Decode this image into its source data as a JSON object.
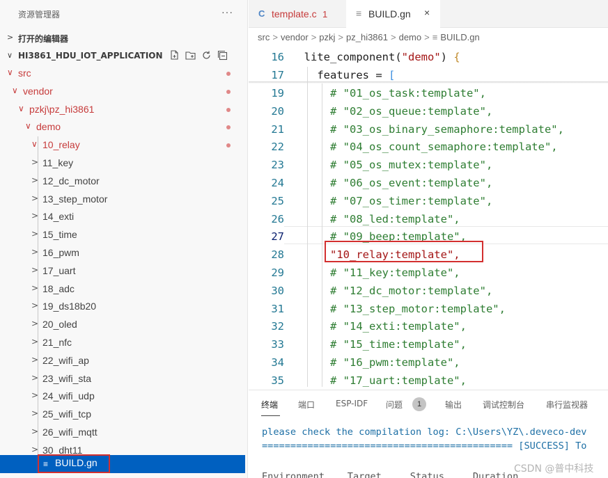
{
  "sidebar": {
    "title": "资源管理器",
    "more": "···",
    "open_editors": {
      "label": "打开的编辑器",
      "chevron": ">"
    },
    "project": {
      "label": "HI3861_HDU_IOT_APPLICATION",
      "chevron": "∨"
    },
    "tree": [
      {
        "label": "src",
        "twisty": "∨",
        "modified": true
      },
      {
        "label": "vendor",
        "twisty": "∨",
        "modified": true
      },
      {
        "label": "pzkj\\pz_hi3861",
        "twisty": "∨",
        "modified": true
      },
      {
        "label": "demo",
        "twisty": "∨",
        "modified": true
      },
      {
        "label": "10_relay",
        "twisty": "∨",
        "modified": true
      },
      {
        "label": "11_key",
        "twisty": ">"
      },
      {
        "label": "12_dc_motor",
        "twisty": ">"
      },
      {
        "label": "13_step_motor",
        "twisty": ">"
      },
      {
        "label": "14_exti",
        "twisty": ">"
      },
      {
        "label": "15_time",
        "twisty": ">"
      },
      {
        "label": "16_pwm",
        "twisty": ">"
      },
      {
        "label": "17_uart",
        "twisty": ">"
      },
      {
        "label": "18_adc",
        "twisty": ">"
      },
      {
        "label": "19_ds18b20",
        "twisty": ">"
      },
      {
        "label": "20_oled",
        "twisty": ">"
      },
      {
        "label": "21_nfc",
        "twisty": ">"
      },
      {
        "label": "22_wifi_ap",
        "twisty": ">"
      },
      {
        "label": "23_wifi_sta",
        "twisty": ">"
      },
      {
        "label": "24_wifi_udp",
        "twisty": ">"
      },
      {
        "label": "25_wifi_tcp",
        "twisty": ">"
      },
      {
        "label": "26_wifi_mqtt",
        "twisty": ">"
      },
      {
        "label": "30_dht11",
        "twisty": ">"
      }
    ],
    "selected_file": {
      "label": "BUILD.gn",
      "icon": "≡"
    }
  },
  "tabs": [
    {
      "icon": "C",
      "label": "template.c",
      "badge": "1"
    },
    {
      "icon": "≡",
      "label": "BUILD.gn",
      "close": "×"
    }
  ],
  "breadcrumb": [
    "src",
    "vendor",
    "pzkj",
    "pz_hi3861",
    "demo",
    "BUILD.gn"
  ],
  "breadcrumb_sep": ">",
  "breadcrumb_file_icon": "≡",
  "code": [
    {
      "num": "16",
      "pre": "  ",
      "kw": "lite_component(",
      "str": "\"demo\"",
      "post": ") ",
      "brace": "{"
    },
    {
      "num": "17",
      "pre": "    ",
      "kw": "features = ",
      "bracket": "["
    },
    {
      "num": "19",
      "text": "      # \"01_os_task:template\","
    },
    {
      "num": "20",
      "text": "      # \"02_os_queue:template\","
    },
    {
      "num": "21",
      "text": "      # \"03_os_binary_semaphore:template\","
    },
    {
      "num": "22",
      "text": "      # \"04_os_count_semaphore:template\","
    },
    {
      "num": "23",
      "text": "      # \"05_os_mutex:template\","
    },
    {
      "num": "24",
      "text": "      # \"06_os_event:template\","
    },
    {
      "num": "25",
      "text": "      # \"07_os_timer:template\","
    },
    {
      "num": "26",
      "text": "      # \"08_led:template\","
    },
    {
      "num": "27",
      "text": "      # \"09_beep:template\","
    },
    {
      "num": "28",
      "text": "      \"10_relay:template\","
    },
    {
      "num": "29",
      "text": "      # \"11_key:template\","
    },
    {
      "num": "30",
      "text": "      # \"12_dc_motor:template\","
    },
    {
      "num": "31",
      "text": "      # \"13_step_motor:template\","
    },
    {
      "num": "32",
      "text": "      # \"14_exti:template\","
    },
    {
      "num": "33",
      "text": "      # \"15_time:template\","
    },
    {
      "num": "34",
      "text": "      # \"16_pwm:template\","
    },
    {
      "num": "35",
      "text": "      # \"17_uart:template\","
    }
  ],
  "panel": {
    "tabs": [
      "终端",
      "端口",
      "ESP-IDF",
      "问题",
      "输出",
      "调试控制台",
      "串行监视器"
    ],
    "problems_count": "1",
    "terminal_lines": [
      "please check the compilation log: C:\\Users\\YZ\\.deveco-dev",
      "============================================ [SUCCESS] To",
      "Environment    Target     Status     Duration"
    ]
  },
  "watermark": "CSDN @普中科技"
}
